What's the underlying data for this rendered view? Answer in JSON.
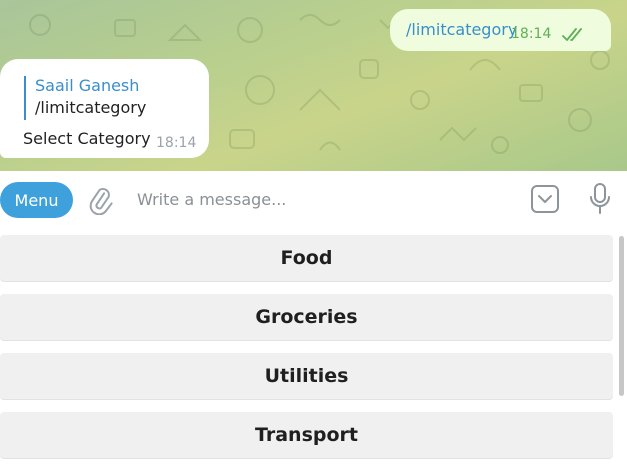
{
  "chat": {
    "outgoing": {
      "text": "/limitcategory",
      "time": "18:14",
      "status_icon": "double-check-icon"
    },
    "incoming": {
      "reply_author": "Saail Ganesh",
      "reply_text": "/limitcategory",
      "text": "Select Category",
      "time": "18:14"
    }
  },
  "composer": {
    "menu_label": "Menu",
    "placeholder": "Write a message..."
  },
  "keyboard": {
    "buttons": [
      "Food",
      "Groceries",
      "Utilities",
      "Transport"
    ]
  },
  "colors": {
    "accent": "#3ea1dc",
    "link": "#3a8ecb",
    "outgoing_bubble": "#effdde",
    "check": "#5fae58",
    "key_bg": "#f0f0f0"
  }
}
